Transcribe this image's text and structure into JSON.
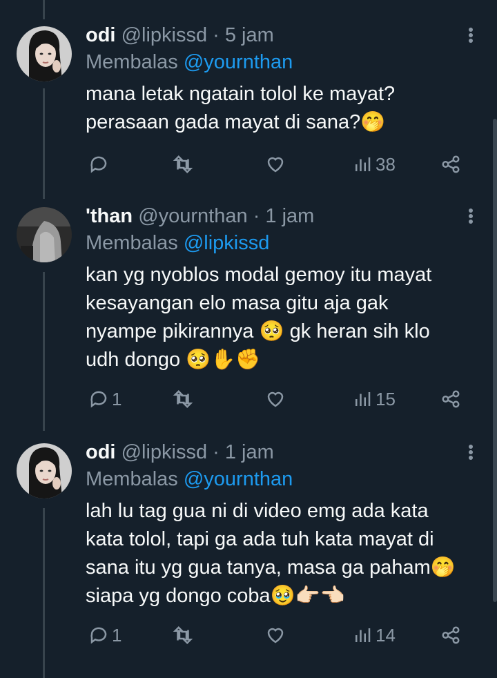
{
  "tweets": [
    {
      "name": "odi",
      "handle": "@lipkissd",
      "time": "· 5 jam",
      "reply_prefix": "Membalas",
      "reply_to": "@yournthan",
      "lines": [
        "mana letak ngatain tolol ke mayat?",
        "perasaan gada mayat di sana?🤭"
      ],
      "replies": "",
      "views": "38"
    },
    {
      "name": "'than",
      "handle": "@yournthan",
      "time": "· 1 jam",
      "reply_prefix": "Membalas",
      "reply_to": "@lipkissd",
      "lines": [
        "kan yg nyoblos modal gemoy itu mayat",
        "kesayangan elo masa gitu aja gak",
        "nyampe pikirannya 🥺 gk heran sih klo",
        "udh dongo 🥺✋✊"
      ],
      "replies": "1",
      "views": "15"
    },
    {
      "name": "odi",
      "handle": "@lipkissd",
      "time": "· 1 jam",
      "reply_prefix": "Membalas",
      "reply_to": "@yournthan",
      "lines": [
        "lah lu tag gua ni di video emg ada kata",
        "kata tolol, tapi ga ada tuh kata mayat di",
        "sana itu yg gua tanya, masa ga paham🤭",
        "siapa yg dongo coba🥹👉🏻👈🏻"
      ],
      "replies": "1",
      "views": "14"
    }
  ],
  "icons": {
    "reply": "reply-icon",
    "retweet": "retweet-icon",
    "like": "heart-icon",
    "views": "views-icon",
    "share": "share-icon",
    "more": "more-vertical-icon"
  }
}
